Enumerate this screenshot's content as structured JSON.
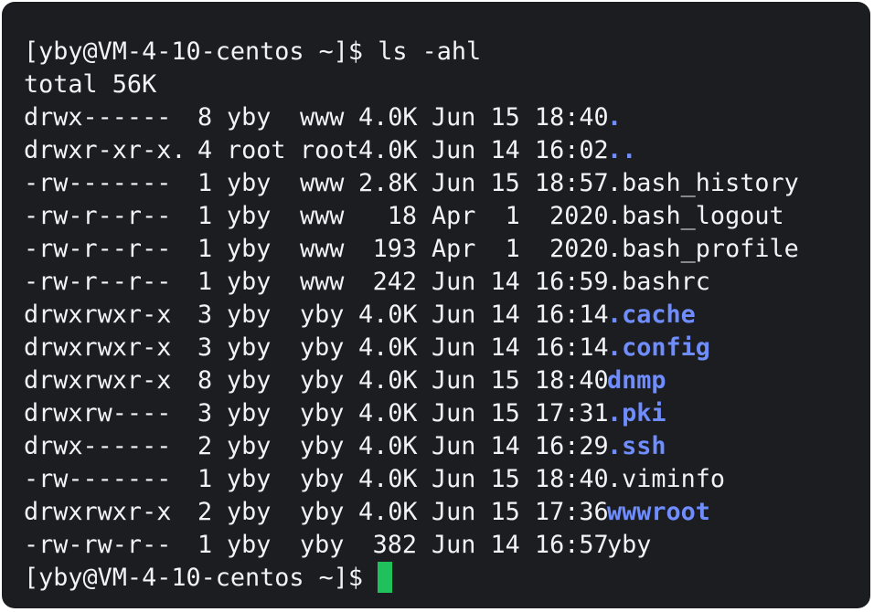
{
  "colors": {
    "background": "#1b1d21",
    "text": "#f2f3f5",
    "directory": "#6f8dff",
    "cursor": "#1fc15d"
  },
  "prompt": "[yby@VM-4-10-centos ~]$",
  "command": "ls -ahl",
  "total": "total 56K",
  "rows": [
    {
      "perm": "drwx------",
      "links": "8",
      "owner": "yby",
      "group": "www",
      "size": "4.0K",
      "date": "Jun 15 18:40",
      "name": ".",
      "is_dir": true
    },
    {
      "perm": "drwxr-xr-x.",
      "links": "4",
      "owner": "root",
      "group": "root",
      "size": "4.0K",
      "date": "Jun 14 16:02",
      "name": "..",
      "is_dir": true
    },
    {
      "perm": "-rw-------",
      "links": "1",
      "owner": "yby",
      "group": "www",
      "size": "2.8K",
      "date": "Jun 15 18:57",
      "name": ".bash_history",
      "is_dir": false
    },
    {
      "perm": "-rw-r--r--",
      "links": "1",
      "owner": "yby",
      "group": "www",
      "size": "18",
      "date": "Apr  1  2020",
      "name": ".bash_logout",
      "is_dir": false
    },
    {
      "perm": "-rw-r--r--",
      "links": "1",
      "owner": "yby",
      "group": "www",
      "size": "193",
      "date": "Apr  1  2020",
      "name": ".bash_profile",
      "is_dir": false
    },
    {
      "perm": "-rw-r--r--",
      "links": "1",
      "owner": "yby",
      "group": "www",
      "size": "242",
      "date": "Jun 14 16:59",
      "name": ".bashrc",
      "is_dir": false
    },
    {
      "perm": "drwxrwxr-x",
      "links": "3",
      "owner": "yby",
      "group": "yby",
      "size": "4.0K",
      "date": "Jun 14 16:14",
      "name": ".cache",
      "is_dir": true
    },
    {
      "perm": "drwxrwxr-x",
      "links": "3",
      "owner": "yby",
      "group": "yby",
      "size": "4.0K",
      "date": "Jun 14 16:14",
      "name": ".config",
      "is_dir": true
    },
    {
      "perm": "drwxrwxr-x",
      "links": "8",
      "owner": "yby",
      "group": "yby",
      "size": "4.0K",
      "date": "Jun 15 18:40",
      "name": "dnmp",
      "is_dir": true
    },
    {
      "perm": "drwxrw----",
      "links": "3",
      "owner": "yby",
      "group": "yby",
      "size": "4.0K",
      "date": "Jun 15 17:31",
      "name": ".pki",
      "is_dir": true
    },
    {
      "perm": "drwx------",
      "links": "2",
      "owner": "yby",
      "group": "yby",
      "size": "4.0K",
      "date": "Jun 14 16:29",
      "name": ".ssh",
      "is_dir": true
    },
    {
      "perm": "-rw-------",
      "links": "1",
      "owner": "yby",
      "group": "yby",
      "size": "4.0K",
      "date": "Jun 15 18:40",
      "name": ".viminfo",
      "is_dir": false
    },
    {
      "perm": "drwxrwxr-x",
      "links": "2",
      "owner": "yby",
      "group": "yby",
      "size": "4.0K",
      "date": "Jun 15 17:36",
      "name": "wwwroot",
      "is_dir": true
    },
    {
      "perm": "-rw-rw-r--",
      "links": "1",
      "owner": "yby",
      "group": "yby",
      "size": "382",
      "date": "Jun 14 16:57",
      "name": "yby",
      "is_dir": false
    }
  ]
}
